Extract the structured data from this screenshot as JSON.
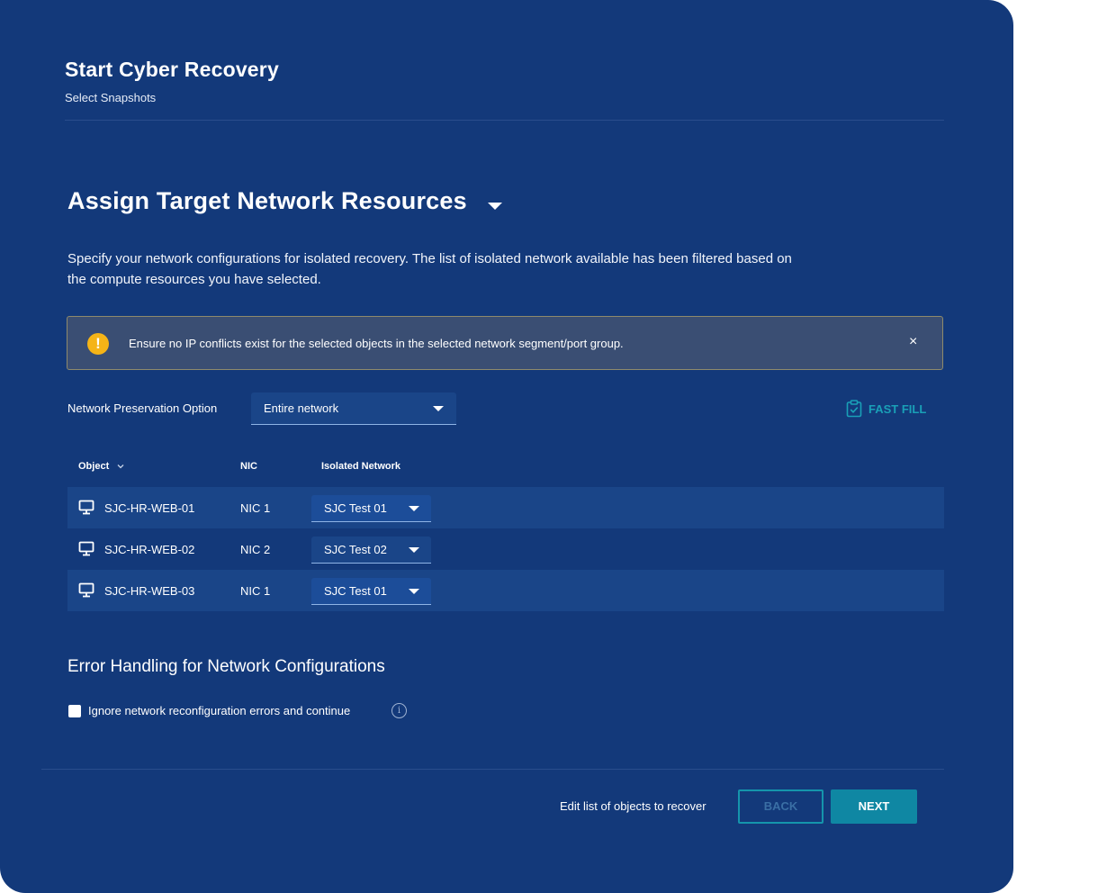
{
  "header": {
    "title": "Start Cyber Recovery",
    "subtitle": "Select Snapshots"
  },
  "section": {
    "title": "Assign Target Network Resources",
    "description": "Specify your network configurations for isolated recovery. The list of isolated network available has been filtered based on the compute resources you have selected."
  },
  "alert": {
    "icon": "warning-icon",
    "text": "Ensure no IP conflicts exist for the selected objects in the selected network segment/port group.",
    "close_label": "×"
  },
  "preservation": {
    "label": "Network Preservation Option",
    "value": "Entire network"
  },
  "fast_fill": {
    "label": "FAST FILL",
    "icon": "clipboard-check-icon"
  },
  "table": {
    "columns": [
      "Object",
      "NIC",
      "Isolated Network"
    ],
    "rows": [
      {
        "object": "SJC-HR-WEB-01",
        "nic": "NIC 1",
        "network": "SJC Test 01"
      },
      {
        "object": "SJC-HR-WEB-02",
        "nic": "NIC 2",
        "network": "SJC Test 02"
      },
      {
        "object": "SJC-HR-WEB-03",
        "nic": "NIC 1",
        "network": "SJC Test 01"
      }
    ]
  },
  "error_handling": {
    "title": "Error Handling for Network Configurations",
    "checkbox_label": "Ignore network reconfiguration errors and continue",
    "checked": false,
    "info_icon": "i"
  },
  "footer": {
    "edit_link": "Edit list of objects to recover",
    "back_label": "BACK",
    "next_label": "NEXT"
  },
  "colors": {
    "panel_bg": "#13397a",
    "row_alt_bg": "#1a4588",
    "accent_teal": "#0f87a3",
    "warning": "#f5b417"
  }
}
